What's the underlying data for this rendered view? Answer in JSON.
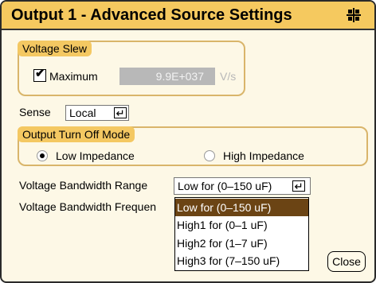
{
  "title": "Output 1 - Advanced Source Settings",
  "voltage_slew": {
    "legend": "Voltage Slew",
    "checkbox_label": "Maximum",
    "checked": true,
    "value": "9.9E+037",
    "unit": "V/s"
  },
  "sense": {
    "label": "Sense",
    "value": "Local"
  },
  "turn_off_mode": {
    "legend": "Output Turn Off Mode",
    "options": [
      {
        "label": "Low Impedance",
        "selected": true
      },
      {
        "label": "High Impedance",
        "selected": false
      }
    ]
  },
  "bandwidth_range": {
    "label": "Voltage Bandwidth Range",
    "value": "Low for (0–150 uF)"
  },
  "bandwidth_frequency": {
    "label": "Voltage Bandwidth Frequen"
  },
  "dropdown_options": [
    {
      "label": "Low for (0–150 uF)",
      "selected": true
    },
    {
      "label": "High1 for (0–1 uF)",
      "selected": false
    },
    {
      "label": "High2 for (1–7 uF)",
      "selected": false
    },
    {
      "label": "High3 for (7–150 uF)",
      "selected": false
    }
  ],
  "close_label": "Close",
  "colors": {
    "titlebar": "#f5c95f",
    "panel": "#fdf8e6",
    "selection": "#6b4414"
  },
  "icons": [
    "move-icon",
    "enter-icon",
    "checkmark-icon"
  ]
}
